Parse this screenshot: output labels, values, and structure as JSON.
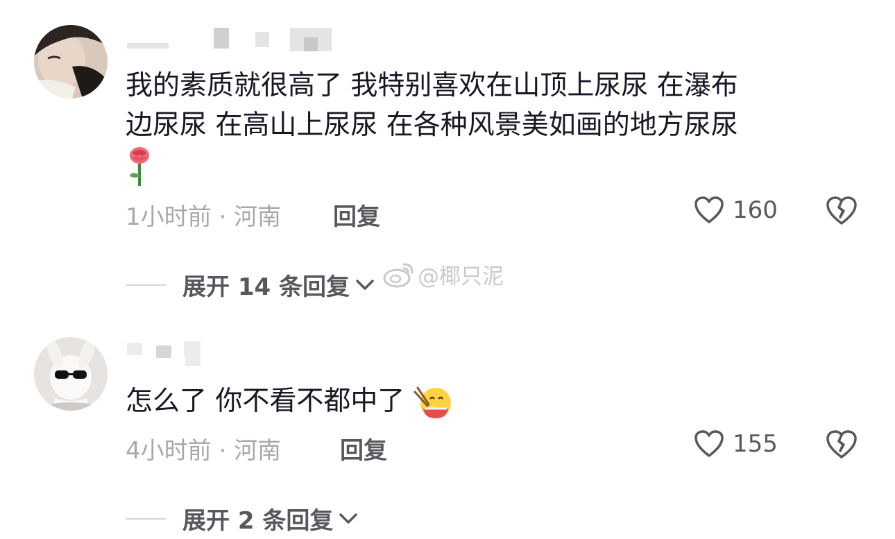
{
  "comments": [
    {
      "text_line1": "我的素质就很高了 我特别喜欢在山顶上尿尿 在瀑布",
      "text_line2": "边尿尿   在高山上尿尿 在各种风景美如画的地方尿尿",
      "emoji": "rose-emoji",
      "meta": "1小时前 · 河南",
      "reply_label": "回复",
      "likes": "160",
      "expand_label": "展开 14 条回复"
    },
    {
      "text_line1": "怎么了 你不看不都中了",
      "emoji": "eating-noodles-emoji",
      "meta": "4小时前 · 河南",
      "reply_label": "回复",
      "likes": "155",
      "expand_label": "展开 2 条回复"
    }
  ],
  "watermark": "@椰只泥",
  "colors": {
    "text": "#161823",
    "meta": "#a8a8ab",
    "action": "#57585d"
  }
}
